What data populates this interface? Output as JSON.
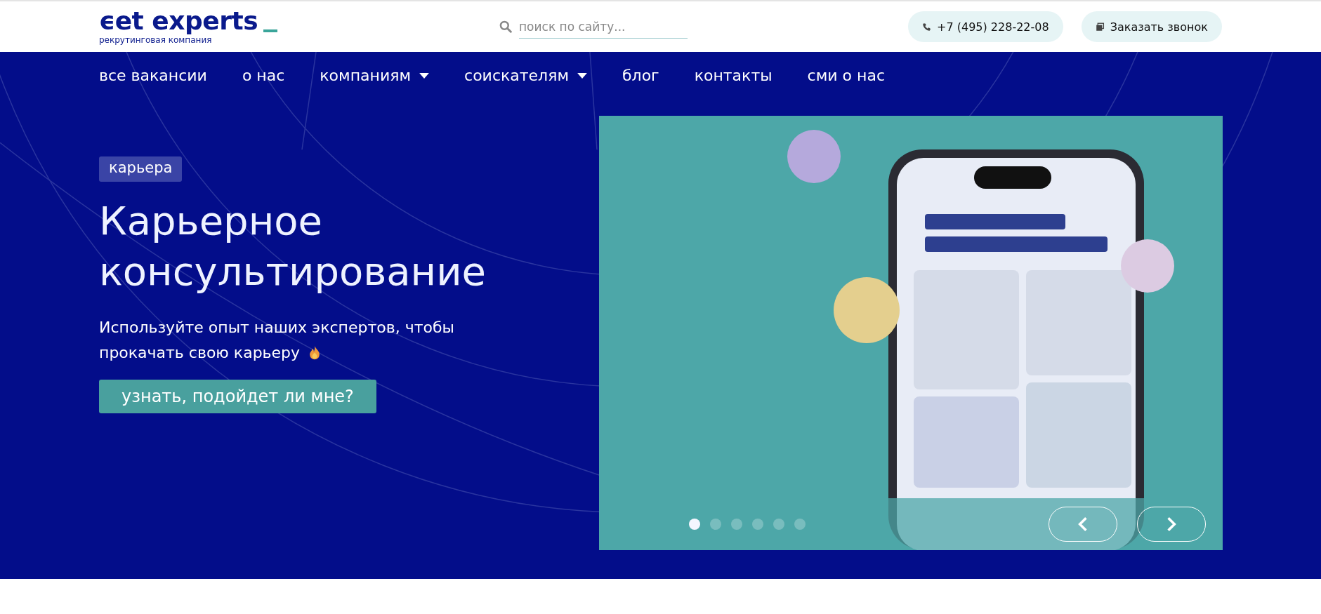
{
  "logo": {
    "name": "ϵet experts",
    "tagline": "рекрутинговая компания"
  },
  "search": {
    "placeholder": "поиск по сайту..."
  },
  "phone": "+7 (495) 228-22-08",
  "callback_button": "Заказать звонок",
  "nav": [
    {
      "label": "все вакансии",
      "dropdown": false
    },
    {
      "label": "о нас",
      "dropdown": false
    },
    {
      "label": "компаниям",
      "dropdown": true
    },
    {
      "label": "соискателям",
      "dropdown": true
    },
    {
      "label": "блог",
      "dropdown": false
    },
    {
      "label": "контакты",
      "dropdown": false
    },
    {
      "label": "сми о нас",
      "dropdown": false
    }
  ],
  "hero": {
    "tag": "карьера",
    "title": "Карьерное консультирование",
    "subtitle": "Используйте опыт наших экспертов, чтобы прокачать свою карьеру",
    "cta": "узнать, подойдет ли мне?"
  },
  "slider": {
    "dots": [
      {
        "selected": true
      },
      {
        "selected": false
      },
      {
        "selected": false
      },
      {
        "selected": false
      },
      {
        "selected": false
      },
      {
        "selected": false
      }
    ]
  }
}
